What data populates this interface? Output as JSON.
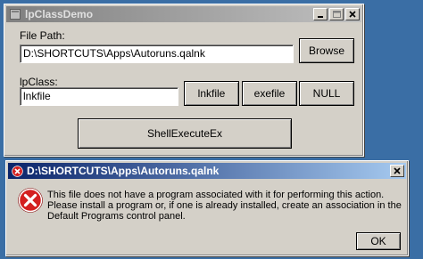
{
  "main_window": {
    "title": "lpClassDemo",
    "file_path_label": "File Path:",
    "file_path_value": "D:\\SHORTCUTS\\Apps\\Autoruns.qalnk",
    "browse_label": "Browse",
    "lpclass_label": "lpClass:",
    "lpclass_value": "lnkfile",
    "lnkfile_label": "lnkfile",
    "exefile_label": "exefile",
    "null_label": "NULL",
    "shellexecute_label": "ShellExecuteEx"
  },
  "dialog": {
    "title": "D:\\SHORTCUTS\\Apps\\Autoruns.qalnk",
    "message": "This file does not have a program associated with it for performing this action. Please install a program or, if one is already installed, create an association in the Default Programs control panel.",
    "ok_label": "OK",
    "icon": "error-icon",
    "error_color": "#d42020"
  }
}
